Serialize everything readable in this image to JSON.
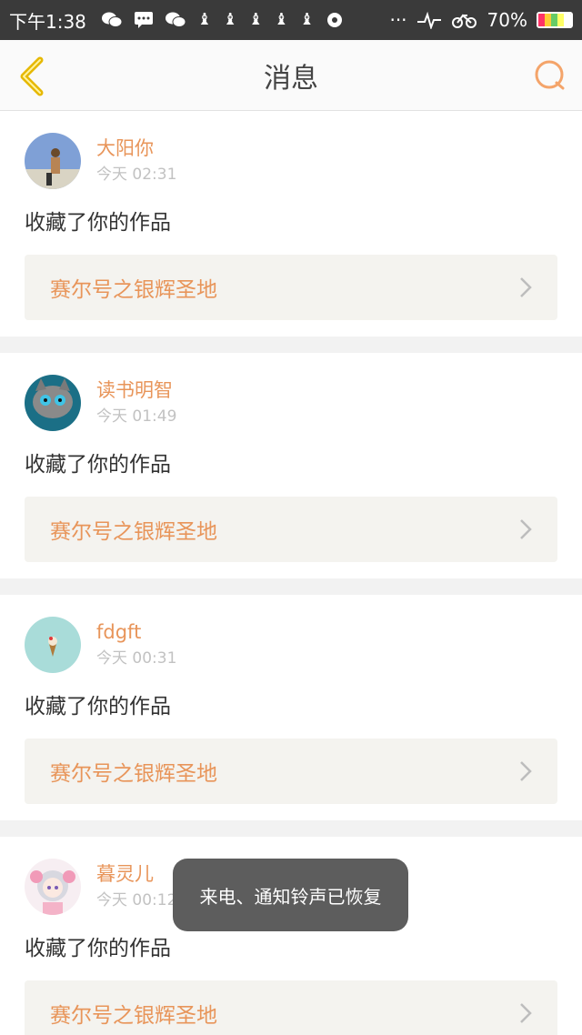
{
  "status_bar": {
    "time": "下午1:38",
    "dots": "···",
    "battery_percent": "70%",
    "icons": [
      "wechat-icon",
      "message-icon",
      "wechat-icon",
      "app-icon",
      "app-icon",
      "app-icon",
      "app-icon",
      "app-icon",
      "chat-bubble-icon",
      "signal-icon",
      "bike-icon",
      "battery-icon"
    ],
    "app_glyph": "♝"
  },
  "nav": {
    "title": "消息"
  },
  "colors": {
    "accent": "#e8955a",
    "back": "#e6b800",
    "search": "#f4a46a"
  },
  "notifications": [
    {
      "user": "大阳你",
      "time": "今天 02:31",
      "action": "收藏了你的作品",
      "work": "赛尔号之银辉圣地"
    },
    {
      "user": "读书明智",
      "time": "今天 01:49",
      "action": "收藏了你的作品",
      "work": "赛尔号之银辉圣地"
    },
    {
      "user": "fdgft",
      "time": "今天 00:31",
      "action": "收藏了你的作品",
      "work": "赛尔号之银辉圣地"
    },
    {
      "user": "暮灵儿",
      "time": "今天 00:12",
      "action": "收藏了你的作品",
      "work": "赛尔号之银辉圣地"
    }
  ],
  "toast": {
    "text": "来电、通知铃声已恢复"
  }
}
